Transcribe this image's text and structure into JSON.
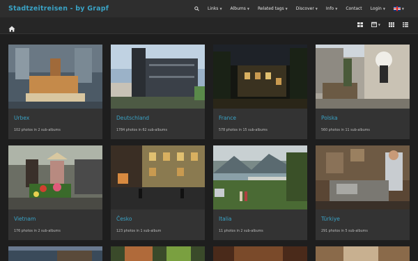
{
  "navbar": {
    "brand": "Stadtzeitreisen - by Grapf",
    "items": [
      {
        "label": "Links",
        "dropdown": true
      },
      {
        "label": "Albums",
        "dropdown": true
      },
      {
        "label": "Related tags",
        "dropdown": true
      },
      {
        "label": "Discover",
        "dropdown": true
      },
      {
        "label": "Info",
        "dropdown": true
      },
      {
        "label": "Contact",
        "dropdown": false
      },
      {
        "label": "Login",
        "dropdown": true
      }
    ],
    "search_icon": "search-icon",
    "language_flag": "uk-flag-icon"
  },
  "subbar": {
    "home_icon": "home-icon",
    "tools": [
      "grid-view-icon",
      "calendar-icon",
      "large-grid-icon",
      "list-view-icon"
    ]
  },
  "albums": [
    {
      "title": "Urbex",
      "meta": "102 photos in 2 sub-albums"
    },
    {
      "title": "Deutschland",
      "meta": "1784 photos in 62 sub-albums"
    },
    {
      "title": "France",
      "meta": "578 photos in 15 sub-albums"
    },
    {
      "title": "Polska",
      "meta": "560 photos in 11 sub-albums"
    },
    {
      "title": "Vietnam",
      "meta": "176 photos in 2 sub-albums"
    },
    {
      "title": "Česko",
      "meta": "123 photos in 1 sub-album"
    },
    {
      "title": "Italia",
      "meta": "11 photos in 2 sub-albums"
    },
    {
      "title": "Türkiye",
      "meta": "291 photos in 5 sub-albums"
    }
  ],
  "colors": {
    "accent": "#3aa3c6",
    "background": "#1e1e1e",
    "navbar": "#2e2e2e",
    "card": "#333333"
  }
}
